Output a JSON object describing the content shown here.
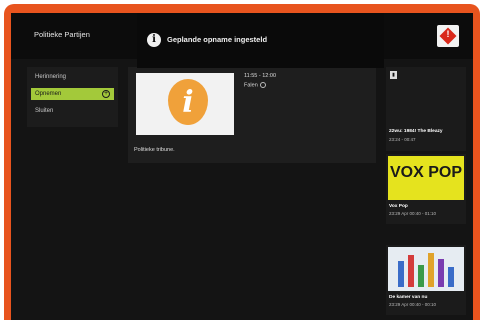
{
  "header": {
    "title": "Politieke Partijen"
  },
  "toast": {
    "icon": "info-icon",
    "message": "Geplande opname ingesteld"
  },
  "menu": {
    "items": [
      {
        "label": "Herinnering"
      },
      {
        "label": "Opnemen"
      },
      {
        "label": "Sluiten"
      }
    ]
  },
  "program": {
    "time": "11:55 - 12:00",
    "status": "Falen",
    "description": "Politieke tribune.",
    "thumb_icon": "info-icon",
    "thumb_letter": "i"
  },
  "rail": {
    "items": [
      {
        "title": "22wu: 1984! The Bleazy",
        "subtitle": "23:24 - 00:47"
      },
      {
        "title": "Vox Pop",
        "subtitle": "23:29 Apr 00:40 - 01:10",
        "image_text": "VOX POP"
      },
      {
        "title": "De kamer van nu",
        "subtitle": "23:29 Apr 00:40 - 00:10"
      }
    ]
  },
  "colors": {
    "accent": "#e8541e",
    "menu_active": "#a3c93a",
    "background": "#141414"
  }
}
